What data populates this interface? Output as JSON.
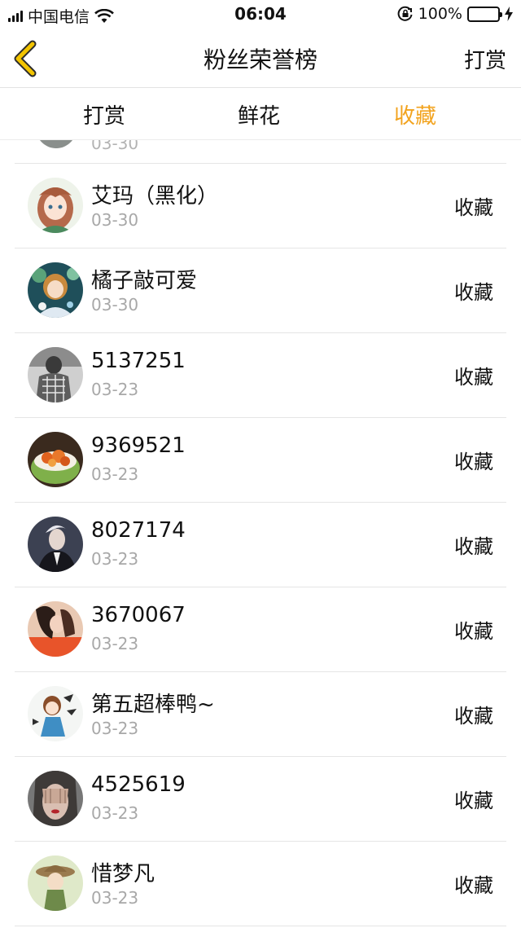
{
  "status_bar": {
    "carrier": "中国电信",
    "time": "06:04",
    "battery": "100%",
    "icons": [
      "signal-icon",
      "wifi-icon",
      "orientation-lock-icon",
      "battery-icon",
      "charging-icon"
    ]
  },
  "nav": {
    "back_icon": "chevron-left-icon",
    "title": "粉丝荣誉榜",
    "action": "打赏"
  },
  "tabs": [
    {
      "label": "打赏",
      "active": false
    },
    {
      "label": "鲜花",
      "active": false
    },
    {
      "label": "收藏",
      "active": true
    }
  ],
  "colors": {
    "accent": "#f2a31e",
    "back_arrow": "#f2c400"
  },
  "list": {
    "partial_top_date": "03-30",
    "rows": [
      {
        "name": "艾玛（黑化）",
        "date": "03-30",
        "action": "收藏"
      },
      {
        "name": "橘子敲可爱",
        "date": "03-30",
        "action": "收藏"
      },
      {
        "name": "5137251",
        "date": "03-23",
        "action": "收藏"
      },
      {
        "name": "9369521",
        "date": "03-23",
        "action": "收藏"
      },
      {
        "name": "8027174",
        "date": "03-23",
        "action": "收藏"
      },
      {
        "name": "3670067",
        "date": "03-23",
        "action": "收藏"
      },
      {
        "name": "第五超棒鸭~",
        "date": "03-23",
        "action": "收藏"
      },
      {
        "name": "4525619",
        "date": "03-23",
        "action": "收藏"
      },
      {
        "name": "惜梦凡",
        "date": "03-23",
        "action": "收藏"
      }
    ]
  }
}
